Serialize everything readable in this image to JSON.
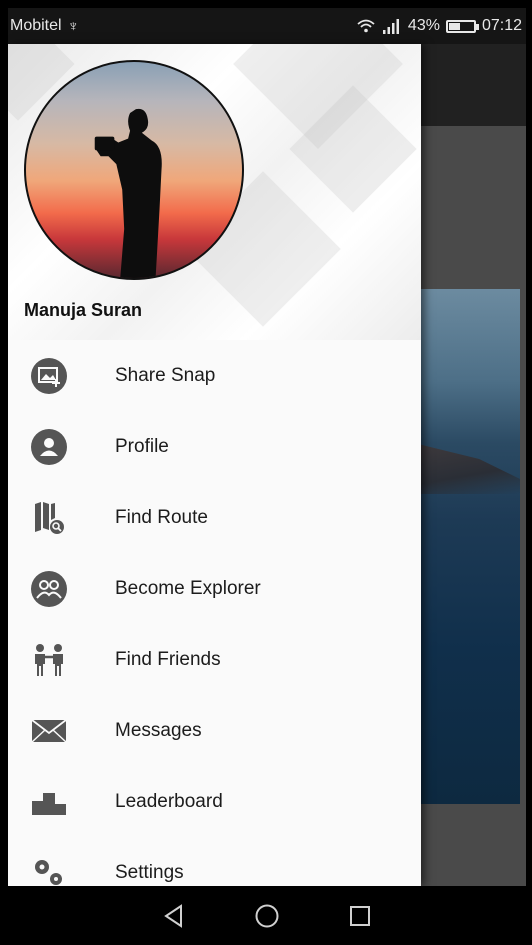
{
  "status_bar": {
    "carrier": "Mobitel",
    "usb_glyph": "♆",
    "battery_percent": "43%",
    "battery_level": 0.43,
    "time": "07:12"
  },
  "drawer": {
    "user_name": "Manuja Suran",
    "menu": [
      {
        "label": "Share Snap",
        "icon": "share-snap-icon"
      },
      {
        "label": "Profile",
        "icon": "profile-icon"
      },
      {
        "label": "Find Route",
        "icon": "find-route-icon"
      },
      {
        "label": "Become Explorer",
        "icon": "become-explorer-icon"
      },
      {
        "label": "Find Friends",
        "icon": "find-friends-icon"
      },
      {
        "label": "Messages",
        "icon": "messages-icon"
      },
      {
        "label": "Leaderboard",
        "icon": "leaderboard-icon"
      },
      {
        "label": "Settings",
        "icon": "settings-icon"
      }
    ]
  },
  "nav_bar": {
    "back": "back-icon",
    "home": "home-icon",
    "recents": "recents-icon"
  },
  "colors": {
    "icon": "#555555",
    "drawer_bg": "#fafafa",
    "toolbar": "#212121"
  }
}
